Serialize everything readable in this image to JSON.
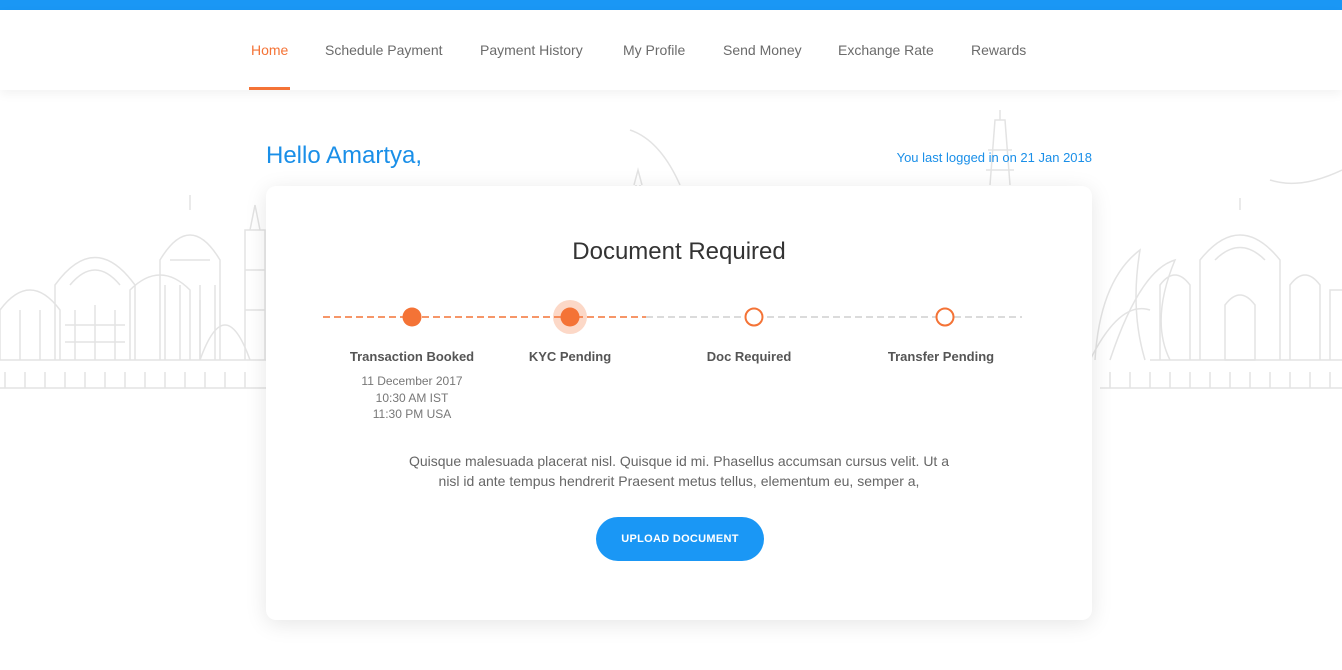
{
  "nav": {
    "items": [
      {
        "label": "Home",
        "active": true
      },
      {
        "label": "Schedule Payment",
        "active": false
      },
      {
        "label": "Payment History",
        "active": false
      },
      {
        "label": "My Profile",
        "active": false
      },
      {
        "label": "Send Money",
        "active": false
      },
      {
        "label": "Exchange Rate",
        "active": false
      },
      {
        "label": "Rewards",
        "active": false
      }
    ]
  },
  "greeting": "Hello Amartya,",
  "last_login": "You last logged in on 21 Jan 2018",
  "card": {
    "title": "Document Required",
    "steps": [
      {
        "label": "Transaction Booked",
        "status": "complete",
        "date": "11 December 2017",
        "time_ist": "10:30 AM IST",
        "time_usa": "11:30 PM USA"
      },
      {
        "label": "KYC Pending",
        "status": "current"
      },
      {
        "label": "Doc Required",
        "status": "pending"
      },
      {
        "label": "Transfer Pending",
        "status": "pending"
      }
    ],
    "description": "Quisque malesuada placerat nisl. Quisque id mi. Phasellus accumsan cursus velit. Ut a nisl id ante tempus hendrerit Praesent metus tellus, elementum eu, semper a,",
    "button_label": "UPLOAD DOCUMENT"
  },
  "colors": {
    "accent": "#f47336",
    "primary": "#1a97f5",
    "top_bar": "#1a97f5"
  }
}
